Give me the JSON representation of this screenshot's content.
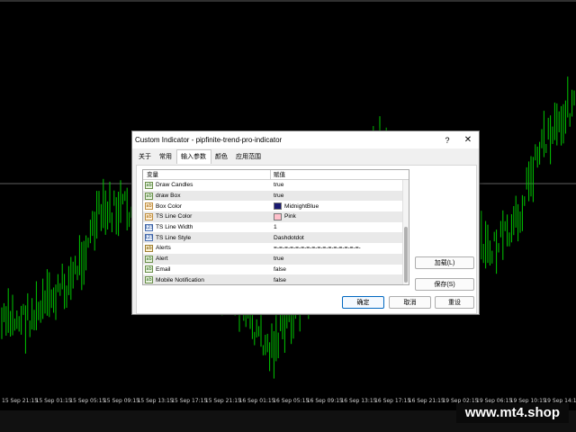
{
  "chart": {
    "time_labels": [
      "15 Sep 21:15",
      "15 Sep 01:15",
      "15 Sep 05:15",
      "15 Sep 09:15",
      "15 Sep 13:15",
      "15 Sep 17:15",
      "15 Sep 21:15",
      "16 Sep 01:15",
      "16 Sep 05:15",
      "16 Sep 09:15",
      "16 Sep 13:15",
      "16 Sep 17:15",
      "16 Sep 21:15",
      "19 Sep 02:15",
      "19 Sep 06:15",
      "19 Sep 10:15",
      "19 Sep 14:15"
    ],
    "bar_color": "#00c800"
  },
  "watermark": "www.mt4.shop",
  "dialog": {
    "title": "Custom Indicator - pipfinite-trend-pro-indicator",
    "help": "?",
    "close": "✕",
    "tabs": [
      {
        "label": "关于"
      },
      {
        "label": "常用"
      },
      {
        "label": "输入参数",
        "active": true
      },
      {
        "label": "颜色"
      },
      {
        "label": "应用范围"
      }
    ],
    "grid": {
      "col_variable": "变量",
      "col_value": "赋值",
      "rows": [
        {
          "icon": "bool-icon",
          "glyph": "ab",
          "name": "Draw Candles",
          "value": "true"
        },
        {
          "icon": "bool-icon",
          "glyph": "ab",
          "name": "draw Box",
          "value": "true"
        },
        {
          "icon": "color-icon",
          "glyph": "ab",
          "name": "Box Color",
          "value": "MidnightBlue",
          "swatch": "#191970"
        },
        {
          "icon": "color-icon",
          "glyph": "ab",
          "name": "TS Line Color",
          "value": "Pink",
          "swatch": "#ffc0cb"
        },
        {
          "icon": "number-icon",
          "glyph": "123",
          "name": "TS Line Width",
          "value": "1"
        },
        {
          "icon": "number-icon",
          "glyph": "123",
          "name": "TS Line Style",
          "value": "Dashdotdot"
        },
        {
          "icon": "text-icon",
          "glyph": "ab",
          "name": "Alerts",
          "value": "=-=-=-=-=-=-=-=-=-=-=-=-=-=-=-=-"
        },
        {
          "icon": "bool-icon",
          "glyph": "ab",
          "name": "Alert",
          "value": "true"
        },
        {
          "icon": "bool-icon",
          "glyph": "ab",
          "name": "Email",
          "value": "false"
        },
        {
          "icon": "bool-icon",
          "glyph": "ab",
          "name": "Mobile Notification",
          "value": "false"
        }
      ]
    },
    "buttons": {
      "load": "加载(L)",
      "save": "保存(S)",
      "ok": "确定",
      "cancel": "取消",
      "reset": "重设"
    }
  }
}
